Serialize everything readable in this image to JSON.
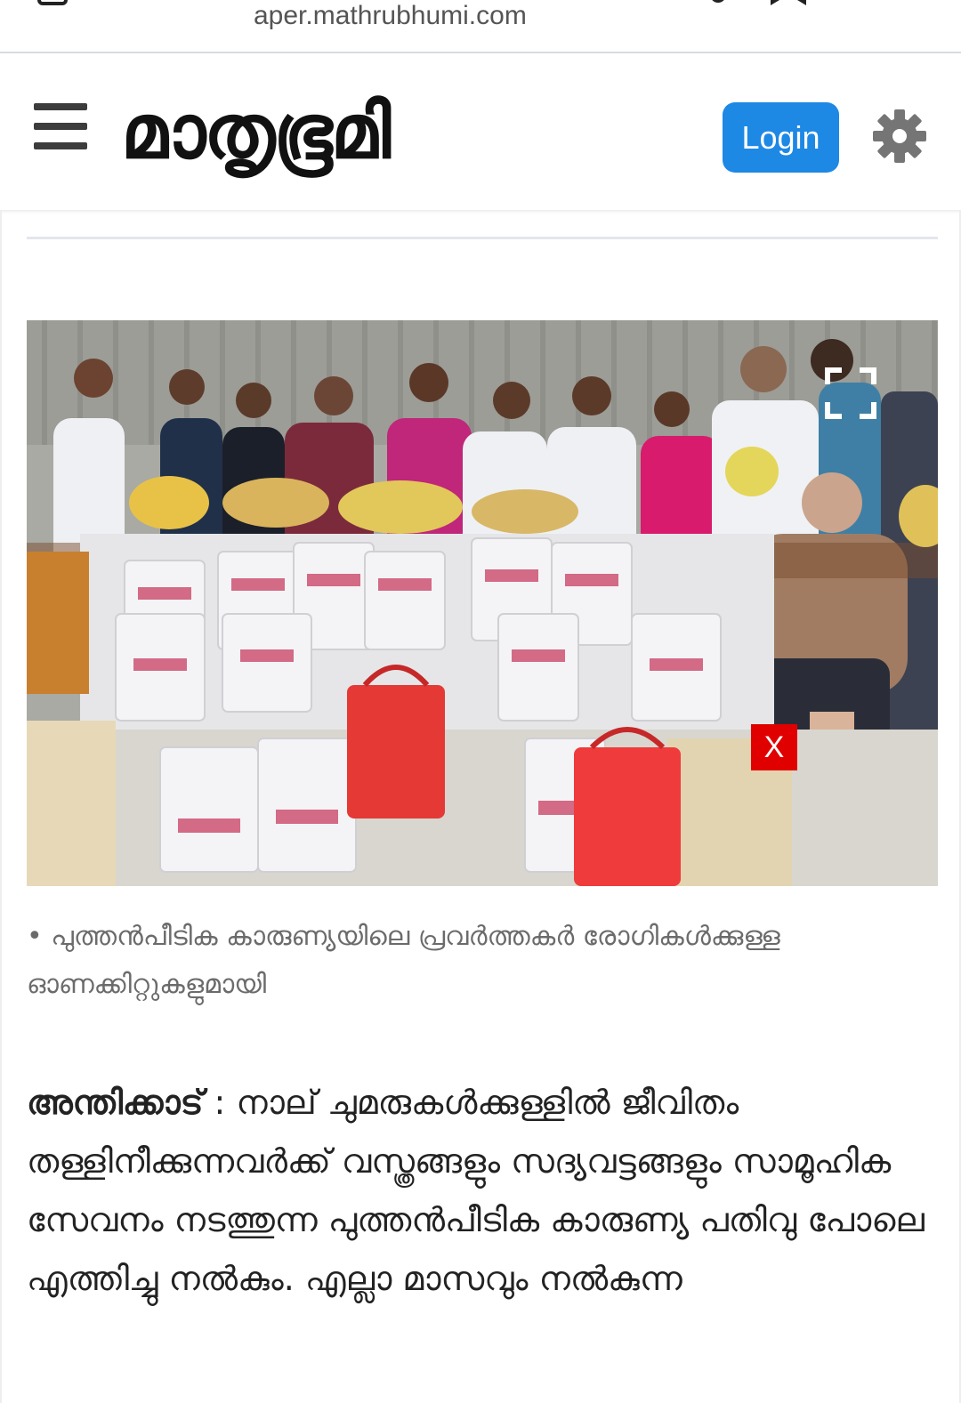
{
  "browser": {
    "url": "aper.mathrubhumi.com",
    "icons": [
      "tab-icon",
      "microphone-icon",
      "bookmark-icon",
      "more-menu-icon"
    ]
  },
  "header": {
    "logo_text": "മാതൃഭൂമി",
    "login_label": "Login",
    "icons": [
      "hamburger-menu-icon",
      "gear-icon"
    ],
    "login_color": "#1e88e5"
  },
  "photo": {
    "icons": [
      "expand-icon"
    ],
    "close_ad_label": "X",
    "close_ad_color": "#e00000"
  },
  "caption": {
    "text": "• പുത്തൻപീടിക കാരുണ്യയിലെ പ്രവർത്തകർ രോഗികൾക്കുള്ള ഓണക്കിറ്റുകളുമായി"
  },
  "article": {
    "dateline": "അന്തിക്കാട്",
    "separator": " : ",
    "body": "നാല് ചുമരുകൾക്കുള്ളിൽ ജീവിതം തള്ളിനീക്കുന്നവർക്ക് വസ്ത്രങ്ങളും സദ്യവട്ടങ്ങളും സാമൂഹിക സേവനം നടത്തുന്ന പുത്തൻപീടിക കാരുണ്യ പതിവു പോലെ എത്തിച്ചു നൽകും. എല്ലാ മാസവും നൽകുന്ന"
  }
}
